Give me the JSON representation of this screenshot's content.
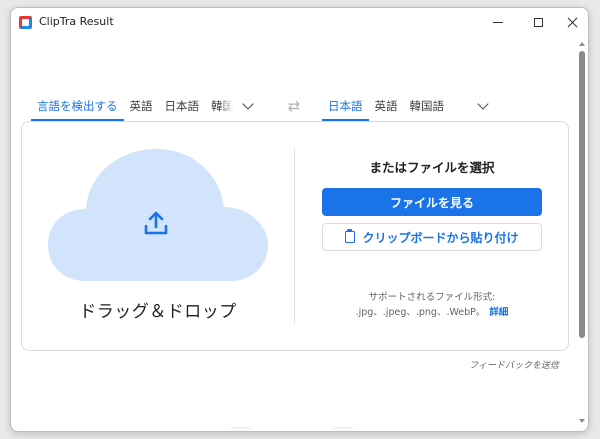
{
  "window": {
    "title": "ClipTra Result"
  },
  "source_languages": [
    {
      "label": "言語を検出する",
      "active": true
    },
    {
      "label": "英語",
      "active": false
    },
    {
      "label": "日本語",
      "active": false
    },
    {
      "label": "韓国語",
      "active": false
    }
  ],
  "target_languages": [
    {
      "label": "日本語",
      "active": true
    },
    {
      "label": "英語",
      "active": false
    },
    {
      "label": "韓国語",
      "active": false
    }
  ],
  "drop_zone": {
    "label": "ドラッグ＆ドロップ"
  },
  "file_panel": {
    "title": "またはファイルを選択",
    "browse_button": "ファイルを見る",
    "paste_button": "クリップボードから貼り付け",
    "supported_label": "サポートされるファイル形式:",
    "formats": ".jpg、.jpeg、.png、.WebP。",
    "details_link": "詳細"
  },
  "footer": {
    "feedback_link": "フィードバックを送信"
  },
  "colors": {
    "accent": "#1a73e8",
    "cloud": "#d2e3fc"
  }
}
